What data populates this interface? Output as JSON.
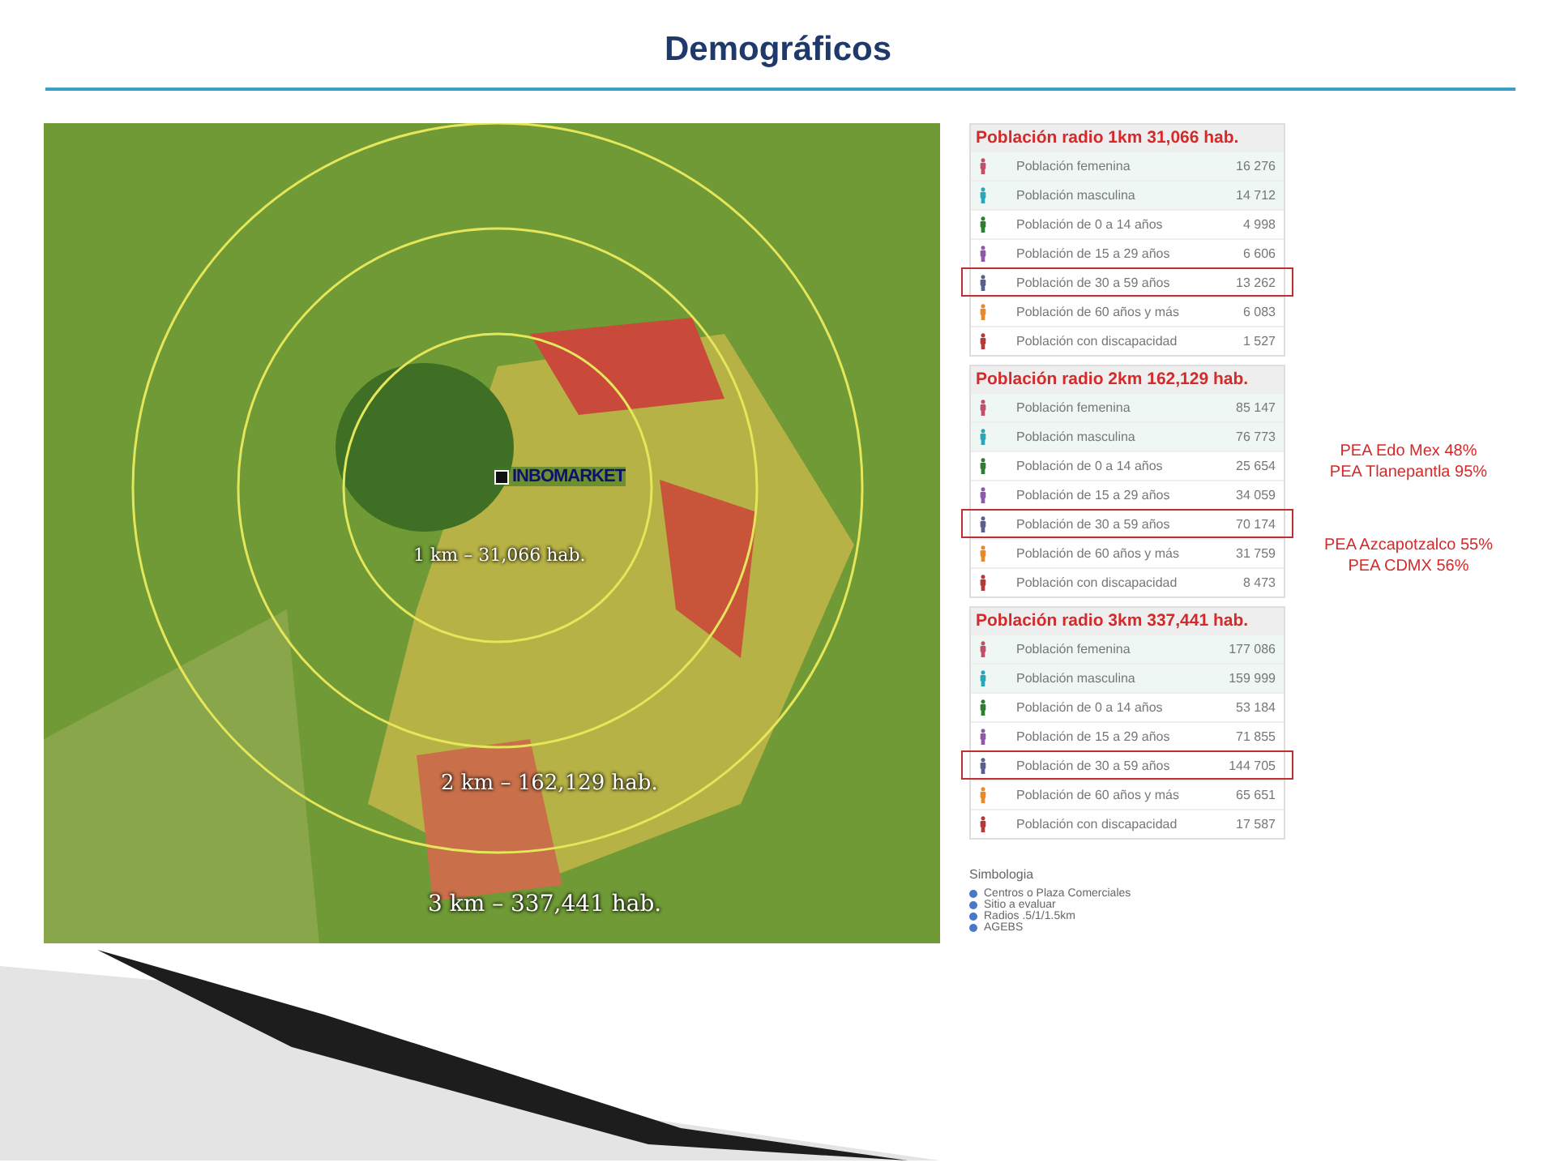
{
  "title": "Demográficos",
  "map": {
    "marker": "INBOMARKET",
    "radius_labels": [
      "1 km – 31,066 hab.",
      "2 km – 162,129 hab.",
      "3 km – 337,441 hab."
    ]
  },
  "tables": [
    {
      "title": "Población radio 1km 31,066 hab.",
      "rows": [
        {
          "label": "Población femenina",
          "value": "16 276",
          "color": "#c0506a",
          "highlighted": false
        },
        {
          "label": "Población masculina",
          "value": "14 712",
          "color": "#2aa6b8",
          "highlighted": false
        },
        {
          "label": "Población de 0 a 14 años",
          "value": "4 998",
          "color": "#2e7d32",
          "highlighted": false
        },
        {
          "label": "Población de 15 a 29 años",
          "value": "6 606",
          "color": "#8e5aa8",
          "highlighted": false
        },
        {
          "label": "Población de 30 a 59 años",
          "value": "13 262",
          "color": "#5a5f8c",
          "highlighted": true
        },
        {
          "label": "Población de 60 años y más",
          "value": "6 083",
          "color": "#e8892b",
          "highlighted": false
        },
        {
          "label": "Población con discapacidad",
          "value": "1 527",
          "color": "#b23a3a",
          "highlighted": false
        }
      ]
    },
    {
      "title": "Población radio 2km 162,129 hab.",
      "rows": [
        {
          "label": "Población femenina",
          "value": "85 147",
          "color": "#c0506a",
          "highlighted": false
        },
        {
          "label": "Población masculina",
          "value": "76 773",
          "color": "#2aa6b8",
          "highlighted": false
        },
        {
          "label": "Población de 0 a 14 años",
          "value": "25 654",
          "color": "#2e7d32",
          "highlighted": false
        },
        {
          "label": "Población de 15 a 29 años",
          "value": "34 059",
          "color": "#8e5aa8",
          "highlighted": false
        },
        {
          "label": "Población de 30 a 59 años",
          "value": "70 174",
          "color": "#5a5f8c",
          "highlighted": true
        },
        {
          "label": "Población de 60 años y más",
          "value": "31 759",
          "color": "#e8892b",
          "highlighted": false
        },
        {
          "label": "Población con discapacidad",
          "value": "8 473",
          "color": "#b23a3a",
          "highlighted": false
        }
      ]
    },
    {
      "title": "Población radio 3km 337,441 hab.",
      "rows": [
        {
          "label": "Población femenina",
          "value": "177 086",
          "color": "#c0506a",
          "highlighted": false
        },
        {
          "label": "Población masculina",
          "value": "159 999",
          "color": "#2aa6b8",
          "highlighted": false
        },
        {
          "label": "Población de 0 a 14 años",
          "value": "53 184",
          "color": "#2e7d32",
          "highlighted": false
        },
        {
          "label": "Población de 15 a 29 años",
          "value": "71 855",
          "color": "#8e5aa8",
          "highlighted": false
        },
        {
          "label": "Población de 30 a 59 años",
          "value": "144 705",
          "color": "#5a5f8c",
          "highlighted": true
        },
        {
          "label": "Población de 60 años y más",
          "value": "65 651",
          "color": "#e8892b",
          "highlighted": false
        },
        {
          "label": "Población con discapacidad",
          "value": "17 587",
          "color": "#b23a3a",
          "highlighted": false
        }
      ]
    }
  ],
  "legend": {
    "title": "Simbologia",
    "items": [
      "Centros o Plaza Comerciales",
      "Sitio a evaluar",
      "Radios .5/1/1.5km",
      "AGEBS"
    ]
  },
  "notes": [
    [
      "PEA Edo Mex 48%",
      "PEA Tlanepantla 95%"
    ],
    [
      "PEA Azcapotzalco 55%",
      "PEA CDMX 56%"
    ]
  ]
}
